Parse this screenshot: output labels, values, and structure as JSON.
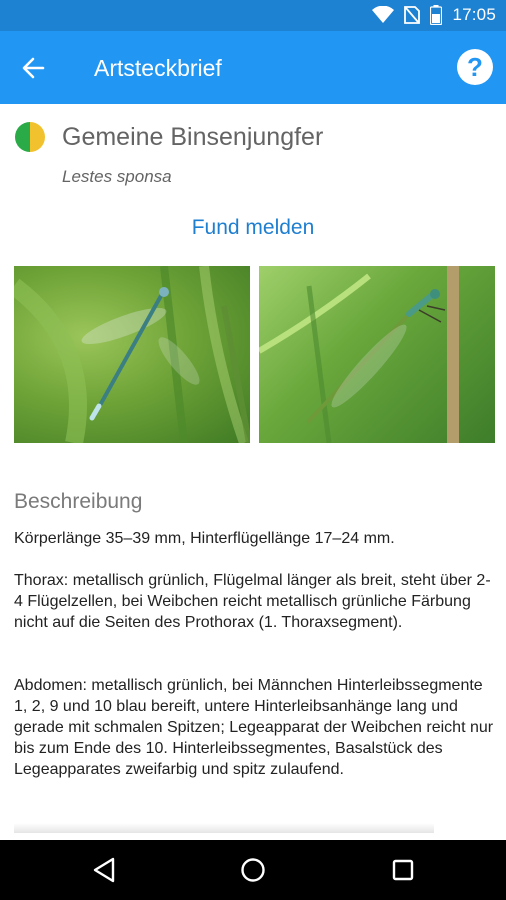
{
  "status": {
    "time": "17:05"
  },
  "toolbar": {
    "title": "Artsteckbrief",
    "back_icon": "arrow-back-icon",
    "help_icon": "help-icon"
  },
  "species": {
    "name": "Gemeine Binsenjungfer",
    "latin": "Lestes sponsa",
    "status_colors": [
      "#2bab48",
      "#f2c12e"
    ]
  },
  "report_link": "Fund melden",
  "photos": [
    {
      "alt": "",
      "caption": ""
    },
    {
      "alt": "",
      "caption": ""
    }
  ],
  "description": {
    "title": "Beschreibung",
    "paragraphs": [
      "Körperlänge 35–39 mm, Hinterflügellänge 17–24 mm.",
      "Thorax: metallisch grünlich, Flügelmal länger als breit, steht über 2-4 Flügelzellen, bei Weibchen reicht metallisch grünliche Färbung nicht auf die Seiten des Prothorax (1. Thoraxsegment).",
      "Abdomen: metallisch grünlich, bei Männchen Hinterleibssegmente 1, 2, 9 und 10 blau bereift, untere Hinterleibsanhänge lang und gerade mit schmalen Spitzen; Legeapparat der Weibchen reicht nur bis zum Ende des 10. Hinterleibssegmentes, Basalstück des Legeapparates zweifarbig und spitz zulaufend."
    ]
  },
  "navigation": {
    "back": "back-triangle-icon",
    "home": "home-circle-icon",
    "recents": "recents-square-icon"
  }
}
